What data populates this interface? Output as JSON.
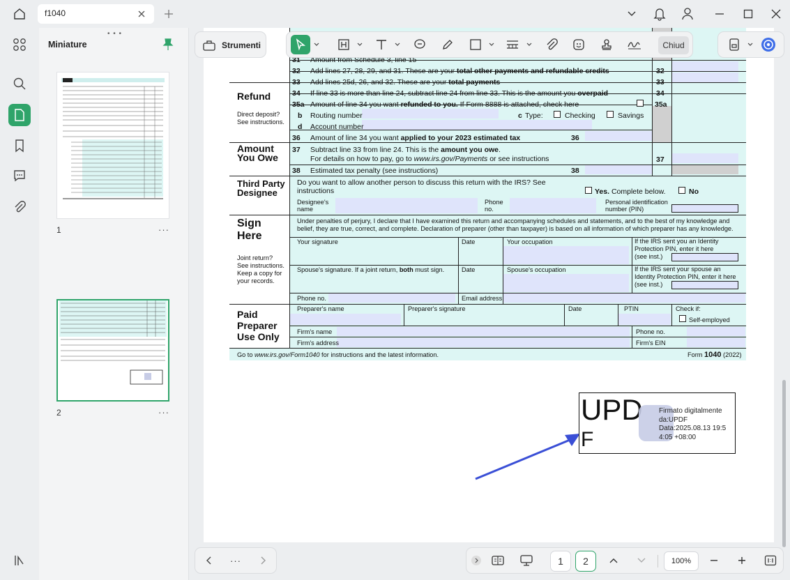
{
  "tab": {
    "title": "f1040"
  },
  "sidebar": {
    "title": "Miniature",
    "pages": [
      "1",
      "2"
    ]
  },
  "toolbar": {
    "strumenti_label": "Strumenti",
    "close_label": "Chiud"
  },
  "pager": {
    "pages": [
      "1",
      "2"
    ],
    "current": "2",
    "zoom": "100%",
    "more": "···"
  },
  "form": {
    "lines": [
      {
        "num": "31",
        "text": "Amount from Schedule 3, line 15"
      },
      {
        "num": "32",
        "text": "Add lines 27, 28, 29, and 31. These are your",
        "bold": "total other payments and refundable credits",
        "box": "32"
      },
      {
        "num": "33",
        "text": "Add lines 25d, 26, and 32. These are your",
        "bold": "total payments",
        "box": "33"
      }
    ],
    "refund": {
      "heading": "Refund",
      "note": "Direct deposit? See instructions.",
      "l34_num": "34",
      "l34_text": "If line 33 is more than line 24, subtract line 24 from line 33. This is the amount you",
      "l34_bold": "overpaid",
      "l34_box": "34",
      "l35_num": "35a",
      "l35_text": "Amount of line 34 you want",
      "l35_bold": "refunded to you.",
      "l35_text2": "If Form 8888 is attached, check here",
      "l35_box": "35a",
      "b_label": "b",
      "routing": "Routing number",
      "c_label": "c",
      "type": "Type:",
      "checking": "Checking",
      "savings": "Savings",
      "d_label": "d",
      "account": "Account number",
      "l36_num": "36",
      "l36_text": "Amount of line 34 you want",
      "l36_bold": "applied to your 2023 estimated tax",
      "l36_box": "36"
    },
    "owe": {
      "heading1": "Amount",
      "heading2": "You Owe",
      "l37_num": "37",
      "l37_text": "Subtract line 33 from line 24. This is the",
      "l37_bold": "amount you owe",
      "l37_text2": "For details on how to pay, go to",
      "l37_url": "www.irs.gov/Payments",
      "l37_text3": "or see instructions",
      "l37_box": "37",
      "l38_num": "38",
      "l38_text": "Estimated tax penalty (see instructions)",
      "l38_box": "38"
    },
    "third_party": {
      "heading1": "Third Party",
      "heading2": "Designee",
      "question1": "Do you want to allow another person to discuss this return with the IRS? See",
      "question2": "instructions",
      "yes": "Yes.",
      "yes_text": "Complete below.",
      "no": "No",
      "designee1": "Designee's",
      "designee2": "name",
      "phone1": "Phone",
      "phone2": "no.",
      "pin1": "Personal identification",
      "pin2": "number (PIN)"
    },
    "sign": {
      "heading1": "Sign",
      "heading2": "Here",
      "penalty1": "Under penalties of perjury, I declare that I have examined this return and accompanying schedules and statements, and to the best of my knowledge and",
      "penalty2": "belief, they are true, correct, and complete. Declaration of preparer (other than taxpayer) is based on all information of which preparer has any knowledge.",
      "your_sig": "Your signature",
      "date": "Date",
      "occupation": "Your occupation",
      "pin_note1": "If the IRS sent you an Identity",
      "pin_note2": "Protection PIN, enter it here",
      "see_inst": "(see inst.)",
      "joint1": "Joint return?",
      "joint2": "See instructions.",
      "joint3": "Keep a copy for",
      "joint4": "your records.",
      "spouse_sig": "Spouse's signature. If a joint return,",
      "spouse_bold": "both",
      "spouse_sig2": "must sign.",
      "spouse_occ": "Spouse's occupation",
      "spouse_pin1": "If the IRS sent your spouse an",
      "spouse_pin2": "Identity Protection PIN, enter it here",
      "phone": "Phone no.",
      "email": "Email address"
    },
    "preparer": {
      "heading1": "Paid",
      "heading2": "Preparer",
      "heading3": "Use Only",
      "name": "Preparer's name",
      "sig": "Preparer's signature",
      "date": "Date",
      "ptin": "PTIN",
      "check_if": "Check if:",
      "self_employed": "Self-employed",
      "firm_name": "Firm's name",
      "phone": "Phone no.",
      "firm_address": "Firm's address",
      "firm_ein": "Firm's EIN"
    },
    "footer": {
      "go_to": "Go to",
      "url": "www.irs.gov/Form1040",
      "rest": "for instructions and the latest information.",
      "form": "Form",
      "form_num": "1040",
      "year": "(2022)"
    }
  },
  "signature": {
    "big1": "UPD",
    "big2": "F",
    "line1": "Firmato digitalmente",
    "line2": "da:UPDF",
    "line3": "Data:2025.08.13 19:5",
    "line4": "4:05 +08:00"
  },
  "colors": {
    "accent": "#2fa46a",
    "form_bg": "#ddf6f4",
    "field": "#dfe4fb",
    "arrow": "#3a4fd6"
  }
}
